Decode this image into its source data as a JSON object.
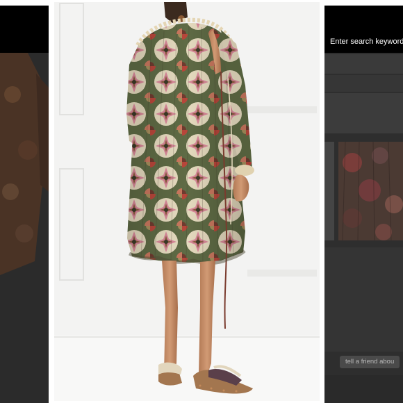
{
  "search": {
    "placeholder": "Enter search keywords h"
  },
  "actions": {
    "tell_a_friend": "tell a friend abou"
  },
  "colors": {
    "overlay_dark": "#2b2b2b",
    "header_black": "#000000",
    "photo_background": "#f4f4f3",
    "dress_green": "#5f6b45",
    "dress_pink": "#d9899a",
    "dress_cream": "#e6dbbf",
    "dress_red": "#b8463a"
  },
  "icons": [
    "product-photo",
    "dress-pattern-image"
  ]
}
